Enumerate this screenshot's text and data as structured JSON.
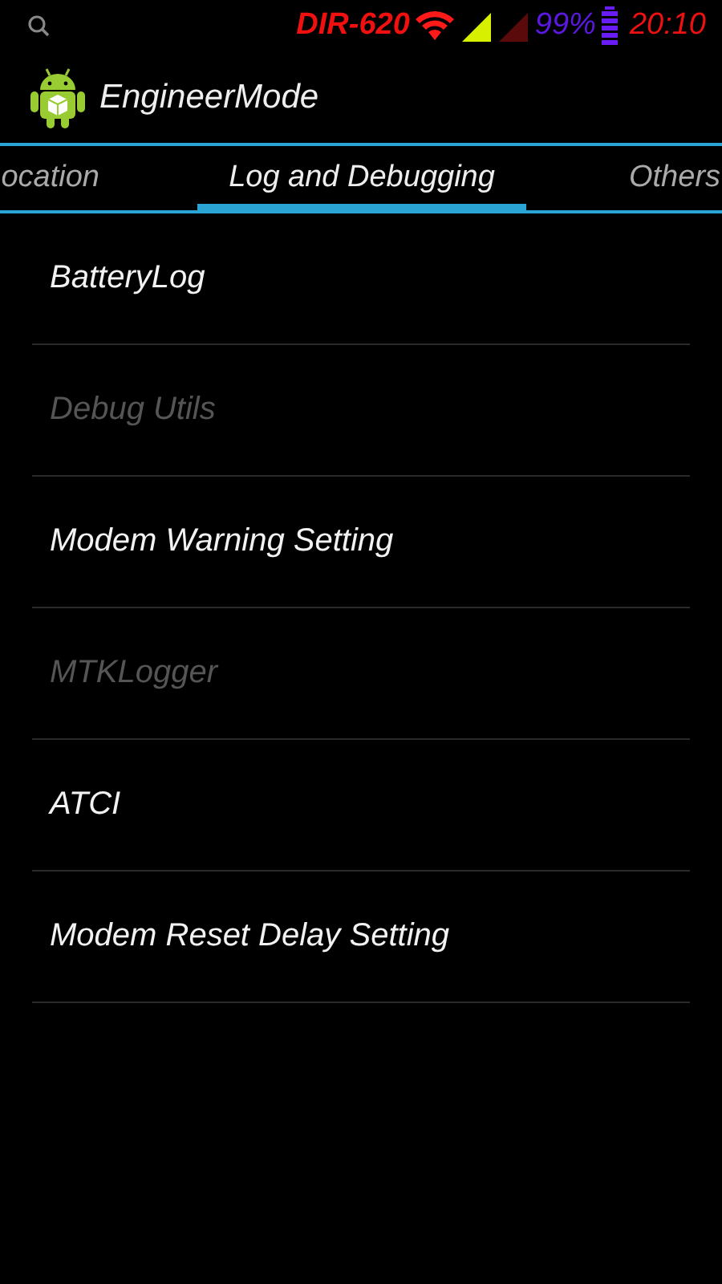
{
  "status_bar": {
    "network_name": "DIR-620",
    "battery_percent": "99%",
    "time": "20:10"
  },
  "action_bar": {
    "title": "EngineerMode"
  },
  "tabs": [
    {
      "label": "ocation",
      "selected": false
    },
    {
      "label": "Log and Debugging",
      "selected": true
    },
    {
      "label": "Others",
      "selected": false
    }
  ],
  "items": [
    {
      "label": "BatteryLog",
      "disabled": false
    },
    {
      "label": "Debug Utils",
      "disabled": true
    },
    {
      "label": "Modem Warning Setting",
      "disabled": false
    },
    {
      "label": "MTKLogger",
      "disabled": true
    },
    {
      "label": "ATCI",
      "disabled": false
    },
    {
      "label": "Modem Reset Delay Setting",
      "disabled": false
    }
  ]
}
